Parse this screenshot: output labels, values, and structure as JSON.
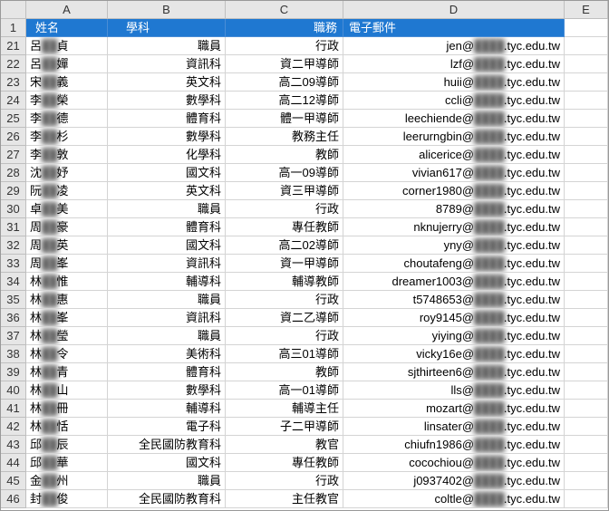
{
  "columns": [
    "A",
    "B",
    "C",
    "D",
    "E"
  ],
  "header_row_num": "1",
  "headers": {
    "a": "姓名",
    "b": "學科",
    "c": "職務",
    "d": "電子郵件"
  },
  "email_domain": ".tyc.edu.tw",
  "rows": [
    {
      "n": "21",
      "a": "呂",
      "am": "██",
      "as": "貞",
      "b": "職員",
      "c": "行政",
      "d": "jen@"
    },
    {
      "n": "22",
      "a": "呂",
      "am": "██",
      "as": "嬋",
      "b": "資訊科",
      "c": "資二甲導師",
      "d": "lzf@"
    },
    {
      "n": "23",
      "a": "宋",
      "am": "██",
      "as": "義",
      "b": "英文科",
      "c": "高二09導師",
      "d": "huii@"
    },
    {
      "n": "24",
      "a": "李",
      "am": "██",
      "as": "榮",
      "b": "數學科",
      "c": "高二12導師",
      "d": "ccli@"
    },
    {
      "n": "25",
      "a": "李",
      "am": "██",
      "as": "德",
      "b": "體育科",
      "c": "體一甲導師",
      "d": "leechiende@"
    },
    {
      "n": "26",
      "a": "李",
      "am": "██",
      "as": "杉",
      "b": "數學科",
      "c": "教務主任",
      "d": "leerurngbin@"
    },
    {
      "n": "27",
      "a": "李",
      "am": "██",
      "as": "敦",
      "b": "化學科",
      "c": "教師",
      "d": "alicerice@"
    },
    {
      "n": "28",
      "a": "沈",
      "am": "██",
      "as": "妤",
      "b": "國文科",
      "c": "高一09導師",
      "d": "vivian617@"
    },
    {
      "n": "29",
      "a": "阮",
      "am": "██",
      "as": "凌",
      "b": "英文科",
      "c": "資三甲導師",
      "d": "corner1980@"
    },
    {
      "n": "30",
      "a": "卓",
      "am": "██",
      "as": "美",
      "b": "職員",
      "c": "行政",
      "d": "8789@"
    },
    {
      "n": "31",
      "a": "周",
      "am": "██",
      "as": "豪",
      "b": "體育科",
      "c": "專任教師",
      "d": "nknujerry@"
    },
    {
      "n": "32",
      "a": "周",
      "am": "██",
      "as": "英",
      "b": "國文科",
      "c": "高二02導師",
      "d": "yny@"
    },
    {
      "n": "33",
      "a": "周",
      "am": "██",
      "as": "峯",
      "b": "資訊科",
      "c": "資一甲導師",
      "d": "choutafeng@"
    },
    {
      "n": "34",
      "a": "林",
      "am": "██",
      "as": "惟",
      "b": "輔導科",
      "c": "輔導教師",
      "d": "dreamer1003@"
    },
    {
      "n": "35",
      "a": "林",
      "am": "██",
      "as": "惠",
      "b": "職員",
      "c": "行政",
      "d": "t5748653@"
    },
    {
      "n": "36",
      "a": "林",
      "am": "██",
      "as": "峯",
      "b": "資訊科",
      "c": "資二乙導師",
      "d": "roy9145@"
    },
    {
      "n": "37",
      "a": "林",
      "am": "██",
      "as": "瑩",
      "b": "職員",
      "c": "行政",
      "d": "yiying@"
    },
    {
      "n": "38",
      "a": "林",
      "am": "██",
      "as": "令",
      "b": "美術科",
      "c": "高三01導師",
      "d": "vicky16e@"
    },
    {
      "n": "39",
      "a": "林",
      "am": "██",
      "as": "青",
      "b": "體育科",
      "c": "教師",
      "d": "sjthirteen6@"
    },
    {
      "n": "40",
      "a": "林",
      "am": "██",
      "as": "山",
      "b": "數學科",
      "c": "高一01導師",
      "d": "lls@"
    },
    {
      "n": "41",
      "a": "林",
      "am": "██",
      "as": "冊",
      "b": "輔導科",
      "c": "輔導主任",
      "d": "mozart@"
    },
    {
      "n": "42",
      "a": "林",
      "am": "██",
      "as": "恬",
      "b": "電子科",
      "c": "子二甲導師",
      "d": "linsater@"
    },
    {
      "n": "43",
      "a": "邱",
      "am": "██",
      "as": "辰",
      "b": "全民國防教育科",
      "c": "教官",
      "d": "chiufn1986@"
    },
    {
      "n": "44",
      "a": "邱",
      "am": "██",
      "as": "華",
      "b": "國文科",
      "c": "專任教師",
      "d": "cocochiou@"
    },
    {
      "n": "45",
      "a": "金",
      "am": "██",
      "as": "州",
      "b": "職員",
      "c": "行政",
      "d": "j0937402@"
    },
    {
      "n": "46",
      "a": "封",
      "am": "██",
      "as": "俊",
      "b": "全民國防教育科",
      "c": "主任教官",
      "d": "coltle@"
    }
  ]
}
